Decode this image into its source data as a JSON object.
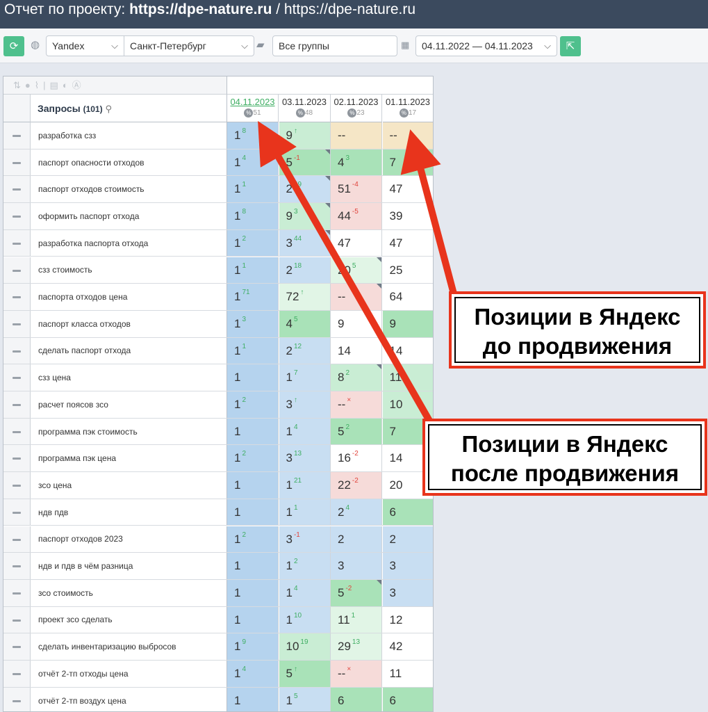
{
  "title": {
    "prefix": "Отчет по проекту: ",
    "bold": "https://dpe-nature.ru",
    "suffix": " / https://dpe-nature.ru"
  },
  "toolbar": {
    "refresh_icon": "refresh-icon",
    "search_engine": "Yandex",
    "region": "Санкт-Петербург",
    "group": "Все группы",
    "date_range": "04.11.2022 — 04.11.2023",
    "export_icon": "export-icon"
  },
  "table": {
    "query_header": "Запросы",
    "query_count": "(101)",
    "dates": [
      {
        "date": "04.11.2023",
        "count": "51",
        "active": true
      },
      {
        "date": "03.11.2023",
        "count": "48",
        "active": false
      },
      {
        "date": "02.11.2023",
        "count": "23",
        "active": false
      },
      {
        "date": "01.11.2023",
        "count": "17",
        "active": false
      }
    ],
    "rows": [
      {
        "q": "разработка сзз",
        "c": [
          [
            "1",
            "8",
            "up",
            "blue"
          ],
          [
            "9",
            "↑",
            "up",
            "lgreen"
          ],
          [
            "--",
            "",
            "",
            "orange"
          ],
          [
            "--",
            "",
            "",
            "orange"
          ]
        ]
      },
      {
        "q": "паспорт опасности отходов",
        "c": [
          [
            "1",
            "4",
            "up",
            "blue"
          ],
          [
            "5",
            "-1",
            "down",
            "green"
          ],
          [
            "4",
            "3",
            "up",
            "green"
          ],
          [
            "7",
            "",
            "",
            "green"
          ]
        ]
      },
      {
        "q": "паспорт отходов стоимость",
        "c": [
          [
            "1",
            "1",
            "up",
            "blue"
          ],
          [
            "2",
            "49",
            "up",
            "lblue"
          ],
          [
            "51",
            "-4",
            "down",
            "pink"
          ],
          [
            "47",
            "",
            "",
            "white"
          ]
        ]
      },
      {
        "q": "оформить паспорт отхода",
        "c": [
          [
            "1",
            "8",
            "up",
            "blue"
          ],
          [
            "9",
            "3",
            "up",
            "lgreen"
          ],
          [
            "44",
            "-5",
            "down",
            "pink"
          ],
          [
            "39",
            "",
            "",
            "white"
          ]
        ]
      },
      {
        "q": "разработка паспорта отхода",
        "c": [
          [
            "1",
            "2",
            "up",
            "blue"
          ],
          [
            "3",
            "44",
            "up",
            "lblue"
          ],
          [
            "47",
            "",
            "",
            "white"
          ],
          [
            "47",
            "",
            "",
            "white"
          ]
        ]
      },
      {
        "q": "сзз стоимость",
        "c": [
          [
            "1",
            "1",
            "up",
            "blue"
          ],
          [
            "2",
            "18",
            "up",
            "lblue"
          ],
          [
            "20",
            "5",
            "up",
            "vlgreen"
          ],
          [
            "25",
            "",
            "",
            "white"
          ]
        ]
      },
      {
        "q": "паспорта отходов цена",
        "c": [
          [
            "1",
            "71",
            "up",
            "blue"
          ],
          [
            "72",
            "↑",
            "up",
            "vlgreen"
          ],
          [
            "--",
            "",
            "",
            "pink"
          ],
          [
            "64",
            "",
            "",
            "white"
          ]
        ]
      },
      {
        "q": "паспорт класса отходов",
        "c": [
          [
            "1",
            "3",
            "up",
            "blue"
          ],
          [
            "4",
            "5",
            "up",
            "green"
          ],
          [
            "9",
            "",
            "",
            "white"
          ],
          [
            "9",
            "",
            "",
            "green"
          ]
        ]
      },
      {
        "q": "сделать паспорт отхода",
        "c": [
          [
            "1",
            "1",
            "up",
            "blue"
          ],
          [
            "2",
            "12",
            "up",
            "lblue"
          ],
          [
            "14",
            "",
            "",
            "white"
          ],
          [
            "14",
            "",
            "",
            "white"
          ]
        ]
      },
      {
        "q": "сзз цена",
        "c": [
          [
            "1",
            "",
            "",
            "blue"
          ],
          [
            "1",
            "7",
            "up",
            "lblue"
          ],
          [
            "8",
            "2",
            "up",
            "lgreen"
          ],
          [
            "11",
            "",
            "",
            "lgreen"
          ]
        ]
      },
      {
        "q": "расчет поясов зсо",
        "c": [
          [
            "1",
            "2",
            "up",
            "blue"
          ],
          [
            "3",
            "↑",
            "up",
            "lblue"
          ],
          [
            "--",
            "×",
            "down",
            "pink"
          ],
          [
            "10",
            "",
            "",
            "lgreen"
          ]
        ]
      },
      {
        "q": "программа пэк стоимость",
        "c": [
          [
            "1",
            "",
            "",
            "blue"
          ],
          [
            "1",
            "4",
            "up",
            "lblue"
          ],
          [
            "5",
            "2",
            "up",
            "green"
          ],
          [
            "7",
            "",
            "",
            "green"
          ]
        ]
      },
      {
        "q": "программа пэк цена",
        "c": [
          [
            "1",
            "2",
            "up",
            "blue"
          ],
          [
            "3",
            "13",
            "up",
            "lblue"
          ],
          [
            "16",
            "-2",
            "down",
            "white"
          ],
          [
            "14",
            "",
            "",
            "white"
          ]
        ]
      },
      {
        "q": "зсо цена",
        "c": [
          [
            "1",
            "",
            "",
            "blue"
          ],
          [
            "1",
            "21",
            "up",
            "lblue"
          ],
          [
            "22",
            "-2",
            "down",
            "pink"
          ],
          [
            "20",
            "",
            "",
            "white"
          ]
        ]
      },
      {
        "q": "ндв пдв",
        "c": [
          [
            "1",
            "",
            "",
            "blue"
          ],
          [
            "1",
            "1",
            "up",
            "lblue"
          ],
          [
            "2",
            "4",
            "up",
            "lblue"
          ],
          [
            "6",
            "",
            "",
            "green"
          ]
        ]
      },
      {
        "q": "паспорт отходов 2023",
        "c": [
          [
            "1",
            "2",
            "up",
            "blue"
          ],
          [
            "3",
            "-1",
            "down",
            "lblue"
          ],
          [
            "2",
            "",
            "",
            "lblue"
          ],
          [
            "2",
            "",
            "",
            "lblue"
          ]
        ]
      },
      {
        "q": "ндв и пдв в чём разница",
        "c": [
          [
            "1",
            "",
            "",
            "blue"
          ],
          [
            "1",
            "2",
            "up",
            "lblue"
          ],
          [
            "3",
            "",
            "",
            "lblue"
          ],
          [
            "3",
            "",
            "",
            "lblue"
          ]
        ]
      },
      {
        "q": "зсо стоимость",
        "c": [
          [
            "1",
            "",
            "",
            "blue"
          ],
          [
            "1",
            "4",
            "up",
            "lblue"
          ],
          [
            "5",
            "-2",
            "down",
            "green"
          ],
          [
            "3",
            "",
            "",
            "lblue"
          ]
        ]
      },
      {
        "q": "проект зсо сделать",
        "c": [
          [
            "1",
            "",
            "",
            "blue"
          ],
          [
            "1",
            "10",
            "up",
            "lblue"
          ],
          [
            "11",
            "1",
            "up",
            "vlgreen"
          ],
          [
            "12",
            "",
            "",
            "white"
          ]
        ]
      },
      {
        "q": "сделать инвентаризацию выбросов",
        "c": [
          [
            "1",
            "9",
            "up",
            "blue"
          ],
          [
            "10",
            "19",
            "up",
            "lgreen"
          ],
          [
            "29",
            "13",
            "up",
            "vlgreen"
          ],
          [
            "42",
            "",
            "",
            "white"
          ]
        ]
      },
      {
        "q": "отчёт 2-тп отходы цена",
        "c": [
          [
            "1",
            "4",
            "up",
            "blue"
          ],
          [
            "5",
            "↑",
            "up",
            "green"
          ],
          [
            "--",
            "×",
            "down",
            "pink"
          ],
          [
            "11",
            "",
            "",
            "white"
          ]
        ]
      },
      {
        "q": "отчёт 2-тп воздух цена",
        "c": [
          [
            "1",
            "",
            "",
            "blue"
          ],
          [
            "1",
            "5",
            "up",
            "lblue"
          ],
          [
            "6",
            "",
            "",
            "green"
          ],
          [
            "6",
            "",
            "",
            "green"
          ]
        ]
      }
    ]
  },
  "callouts": {
    "before_line1": "Позиции в Яндекс",
    "before_line2": "до продвижения",
    "after_line1": "Позиции в Яндекс",
    "after_line2": "после продвижения"
  },
  "colors": {
    "accent": "#4fc08d",
    "title_bg": "#3b4a5e",
    "arrow": "#e8341c"
  }
}
